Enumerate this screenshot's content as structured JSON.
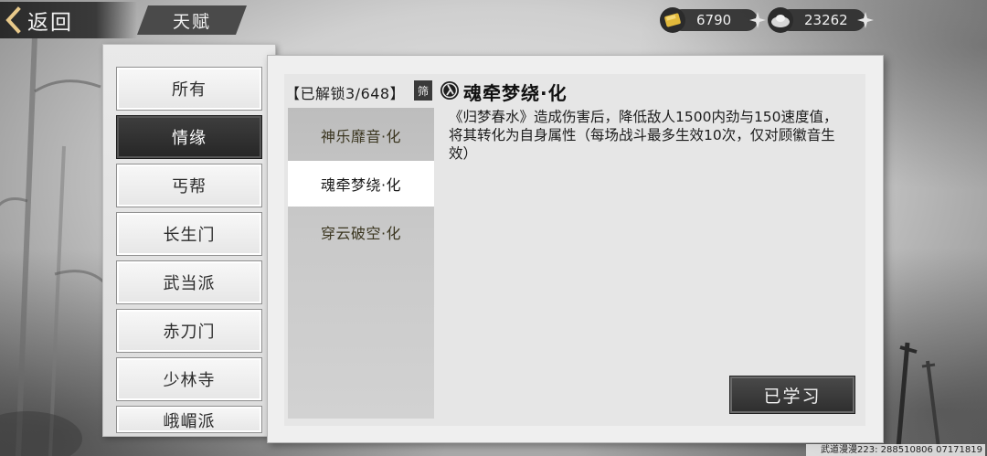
{
  "header": {
    "back_label": "返回",
    "title": "天赋"
  },
  "currency": {
    "gold": {
      "value": "6790",
      "icon": "gold-ingot-icon"
    },
    "silver": {
      "value": "23262",
      "icon": "silver-ingot-icon"
    }
  },
  "categories": [
    {
      "label": "所有",
      "active": false
    },
    {
      "label": "情缘",
      "active": true
    },
    {
      "label": "丐帮",
      "active": false
    },
    {
      "label": "长生门",
      "active": false
    },
    {
      "label": "武当派",
      "active": false
    },
    {
      "label": "赤刀门",
      "active": false
    },
    {
      "label": "少林寺",
      "active": false
    },
    {
      "label": "峨嵋派",
      "active": false
    }
  ],
  "main": {
    "unlock_label": "【已解锁3/648】",
    "filter_label": "筛",
    "talents": [
      {
        "label": "神乐靡音·化",
        "selected": false
      },
      {
        "label": "魂牵梦绕·化",
        "selected": true
      },
      {
        "label": "穿云破空·化",
        "selected": false
      }
    ],
    "detail": {
      "title": "魂牵梦绕·化",
      "description": "《归梦春水》造成伤害后，降低敌人1500内劲与150速度值，将其转化为自身属性（每场战斗最多生效10次，仅对顾徽音生效）"
    },
    "learned_button": "已学习"
  },
  "watermark": "武道漫漫223: 288510806  07171819"
}
